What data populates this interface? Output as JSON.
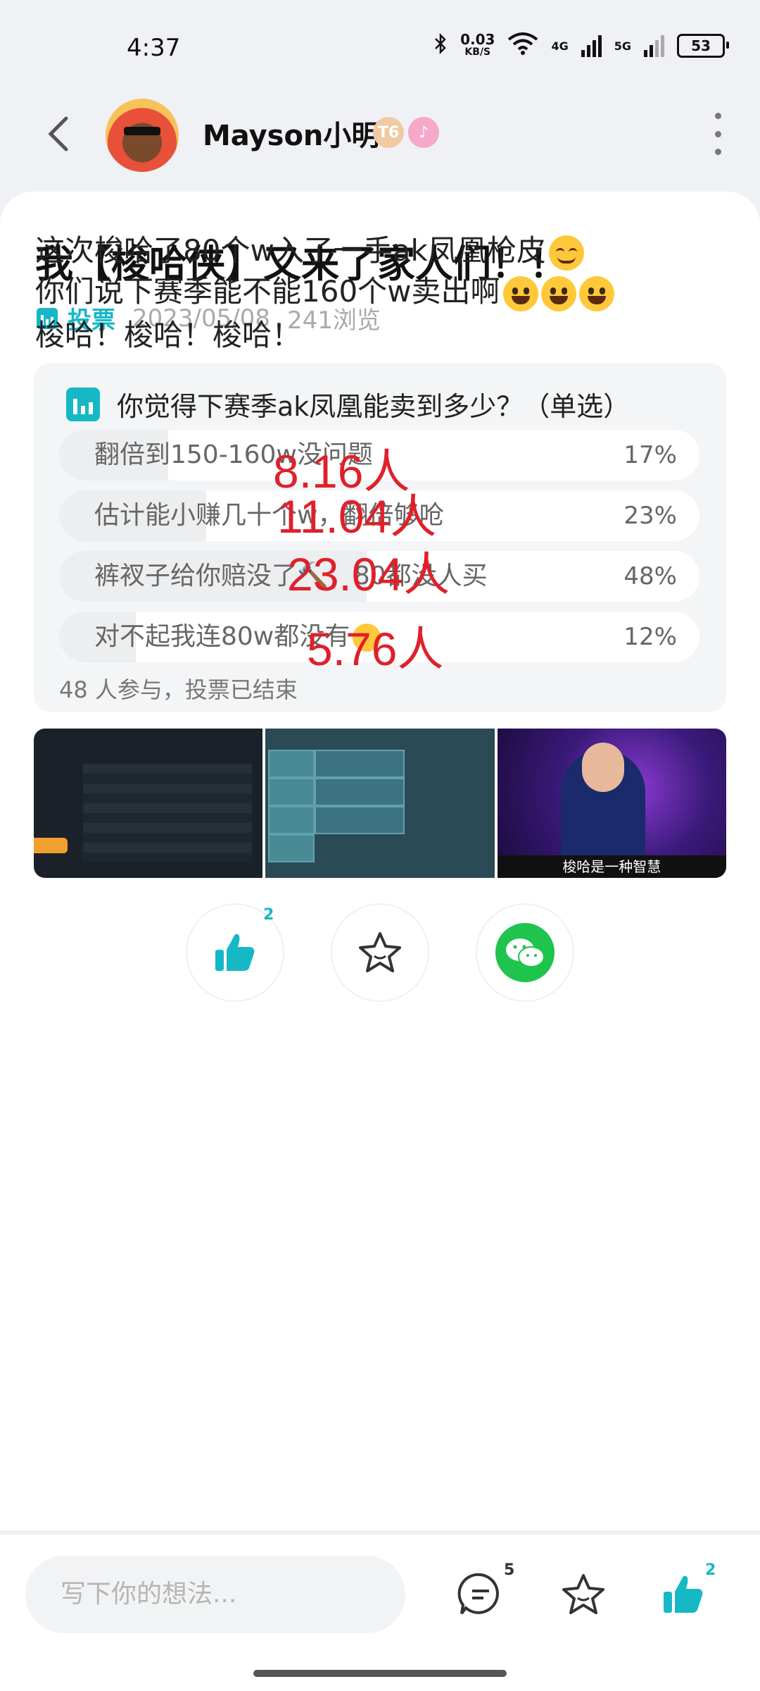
{
  "status": {
    "time": "4:37",
    "net_speed_top": "0.03",
    "net_speed_bottom": "KB/S",
    "net1": "4G",
    "net2": "5G",
    "battery": "53"
  },
  "header": {
    "username": "Mayson小明",
    "level_badge": "T6"
  },
  "post": {
    "title": "我【梭哈侠】又来了家人们！！",
    "tag": "投票",
    "date": "2023/05/08",
    "views": "241浏览",
    "lines": [
      "这次梭哈了80个w入了一手ak凤凰枪皮",
      "你们说下赛季能不能160个w卖出啊",
      "梭哈！梭哈！梭哈！"
    ]
  },
  "poll": {
    "question": "你觉得下赛季ak凤凰能卖到多少？（单选）",
    "options": [
      {
        "label": "翻倍到150-160w没问题",
        "percent": "17%",
        "fraction": 0.17,
        "annotation": "8.16人"
      },
      {
        "label": "估计能小赚几十个w，翻倍够呛",
        "percent": "23%",
        "fraction": 0.23,
        "annotation": "11.04人"
      },
      {
        "label": "裤衩子给你赔没了",
        "label_suffix": "，80都没人买",
        "percent": "48%",
        "fraction": 0.48,
        "annotation": "23.04人"
      },
      {
        "label": "对不起我连80w都没有",
        "percent": "12%",
        "fraction": 0.12,
        "annotation": "5.76人"
      }
    ],
    "footer": "48 人参与，投票已结束"
  },
  "images": {
    "third_caption": "梭哈是一种智慧"
  },
  "actions": {
    "like_count": "2"
  },
  "bottom": {
    "placeholder": "写下你的想法...",
    "comment_count": "5",
    "like_count": "2"
  },
  "colors": {
    "accent": "#17b8c6",
    "wechat": "#1ec44c",
    "annotation": "#e0202a"
  }
}
